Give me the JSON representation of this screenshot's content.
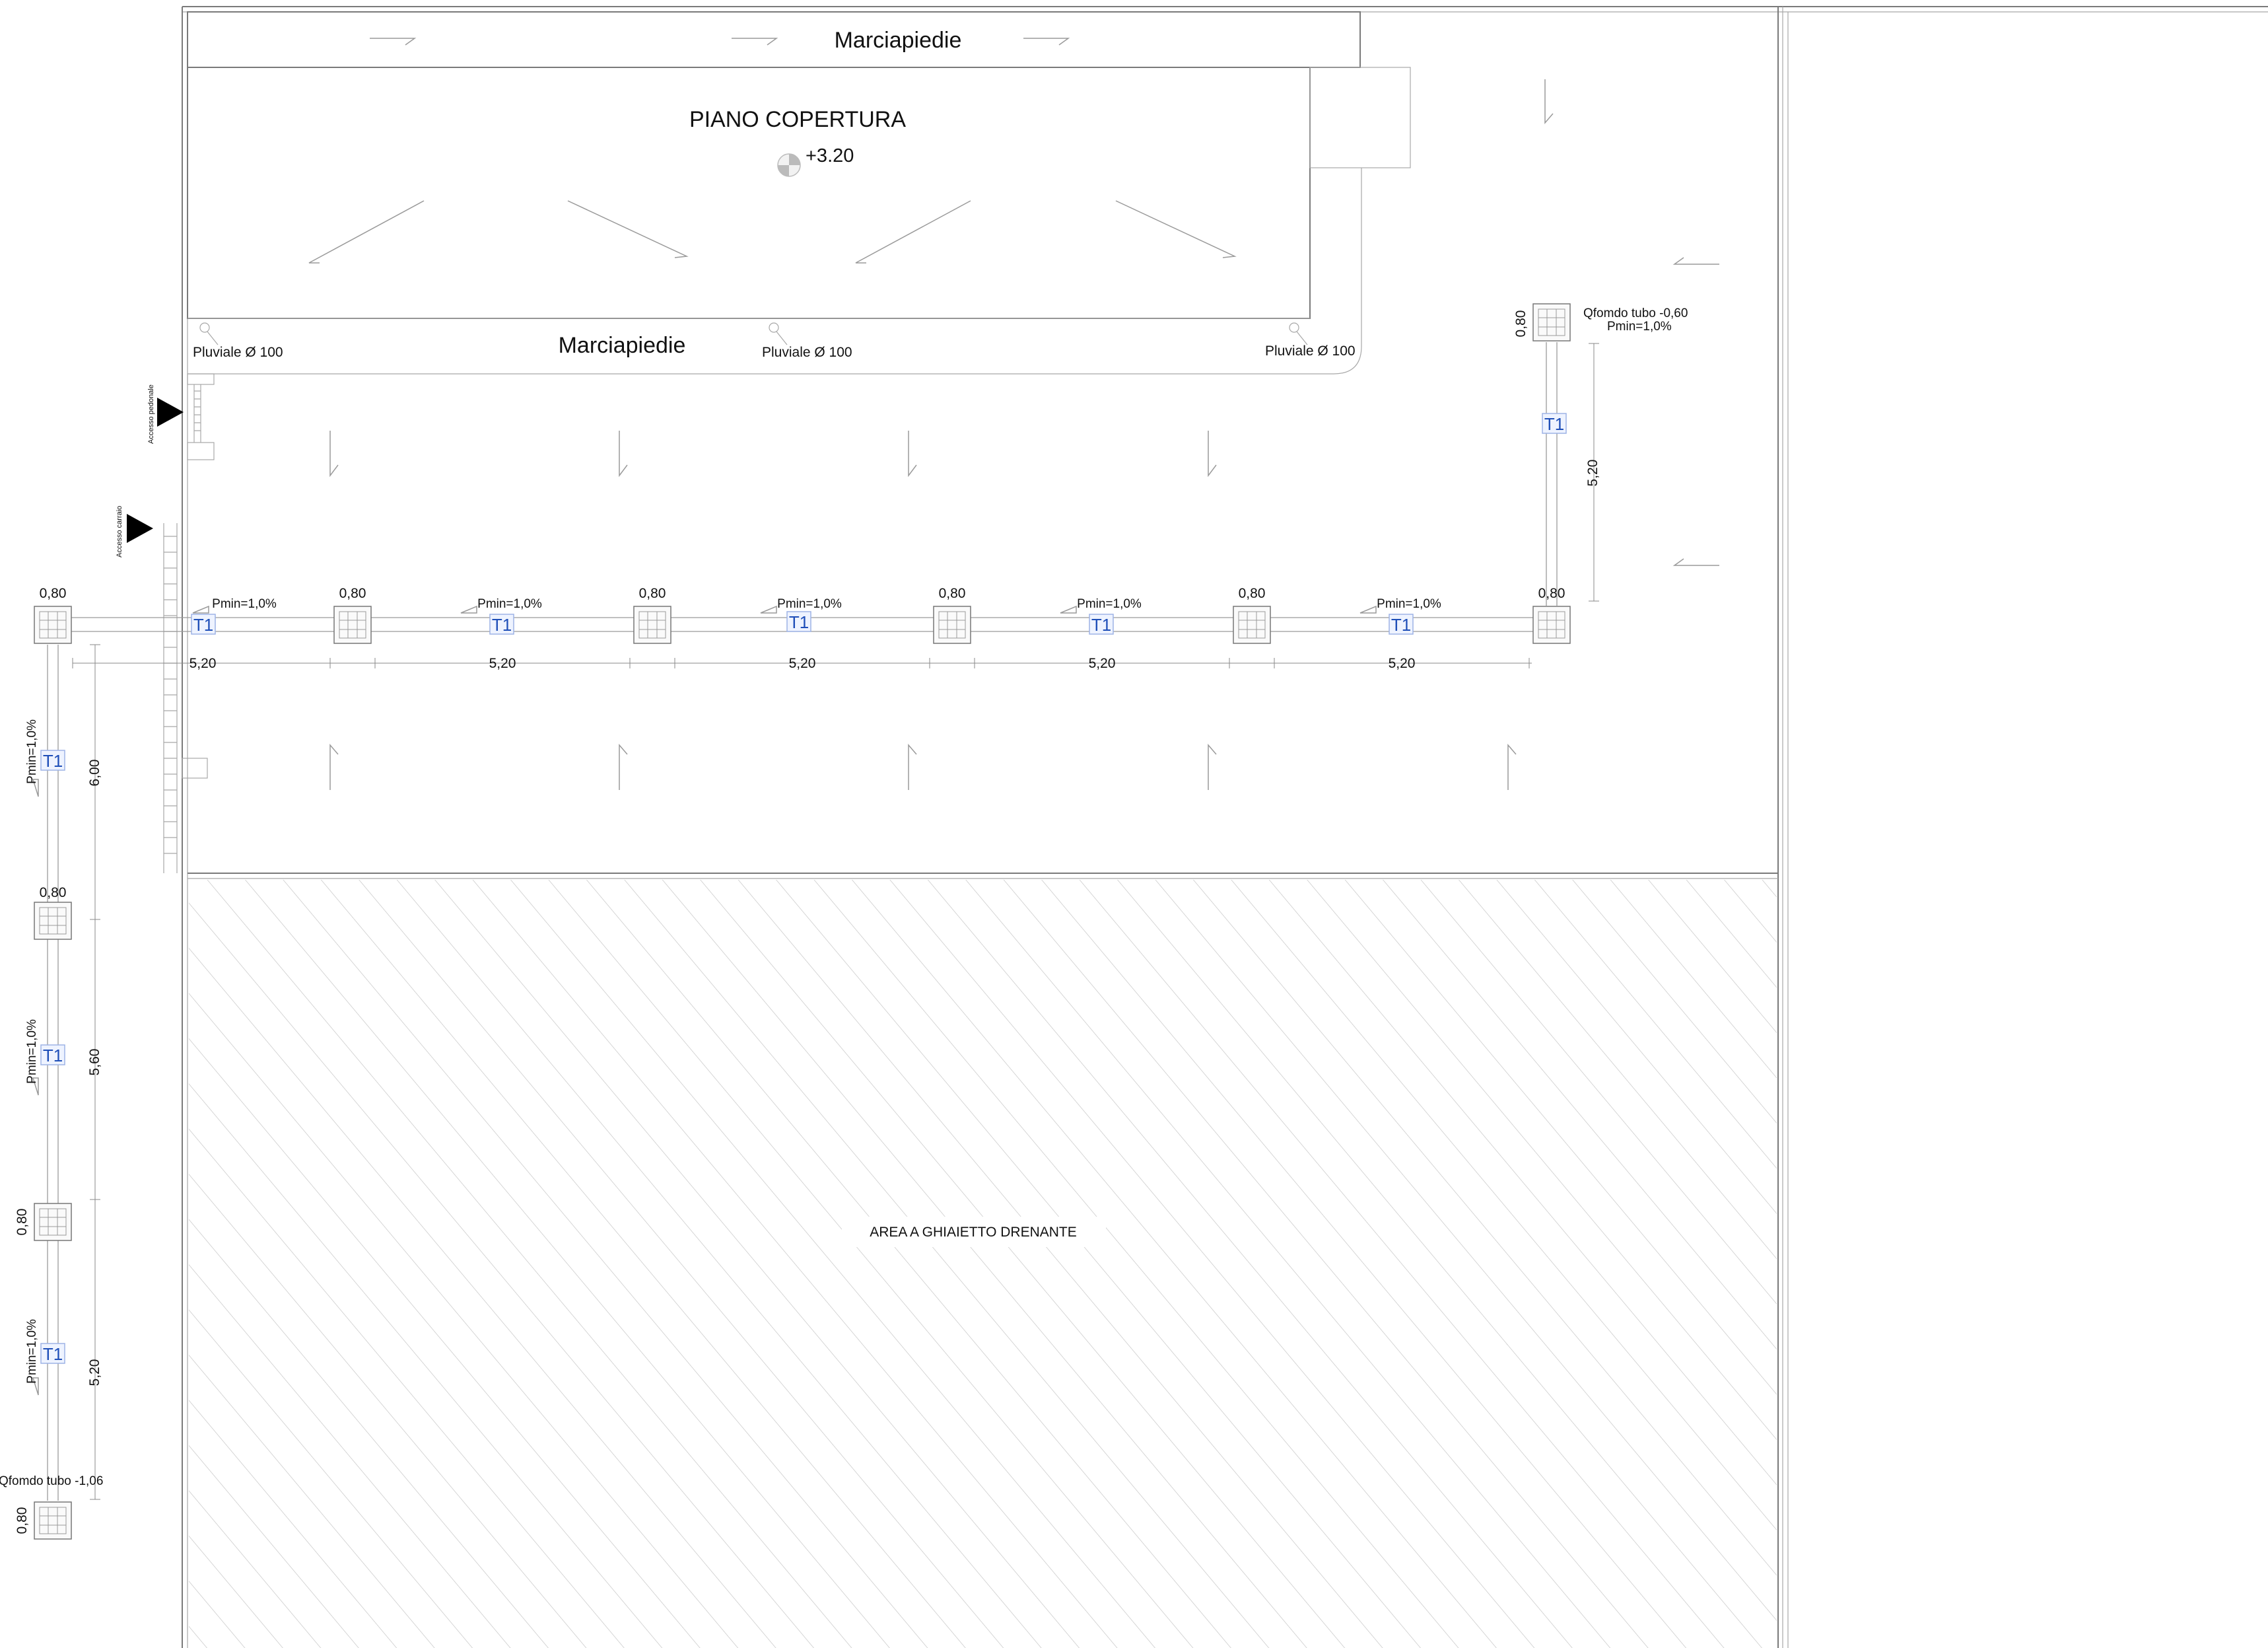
{
  "plan": {
    "sidewalk_top_label": "Marciapiedie",
    "roof_label": "PIANO COPERTURA",
    "roof_level": "+3.20",
    "sidewalk_bottom_label": "Marciapiedie",
    "downpipes": [
      "Pluviale Ø 100",
      "Pluviale Ø 100",
      "Pluviale Ø 100"
    ],
    "access_pedestrian": "Accesso pedonale",
    "access_vehicle": "Accesso carraio",
    "gravel_area": "AREA A GHIAIETTO DRENANTE",
    "right_well_note": "Qfomdo tubo -0,60",
    "right_well_slope": "Pmin=1,0%",
    "bottom_well_note": "Qfomdo tubo -1,06"
  },
  "horizontal_run": {
    "well_sizes": [
      "0,80",
      "0,80",
      "0,80",
      "0,80",
      "0,80",
      "0,80"
    ],
    "slopes": [
      "Pmin=1,0%",
      "Pmin=1,0%",
      "Pmin=1,0%",
      "Pmin=1,0%",
      "Pmin=1,0%"
    ],
    "pipe_tags": [
      "T1",
      "T1",
      "T1",
      "T1",
      "T1"
    ],
    "spans": [
      "5,20",
      "5,20",
      "5,20",
      "5,20",
      "5,20"
    ]
  },
  "right_run": {
    "well_size": "0,80",
    "pipe_tag": "T1",
    "span": "5,20"
  },
  "left_run": {
    "well_sizes": [
      "0,80",
      "0,80",
      "0,80"
    ],
    "slopes": [
      "Pmin=1,0%",
      "Pmin=1,0%",
      "Pmin=1,0%"
    ],
    "pipe_tags": [
      "T1",
      "T1",
      "T1"
    ],
    "spans": [
      "6,00",
      "5,60",
      "5,20"
    ]
  }
}
